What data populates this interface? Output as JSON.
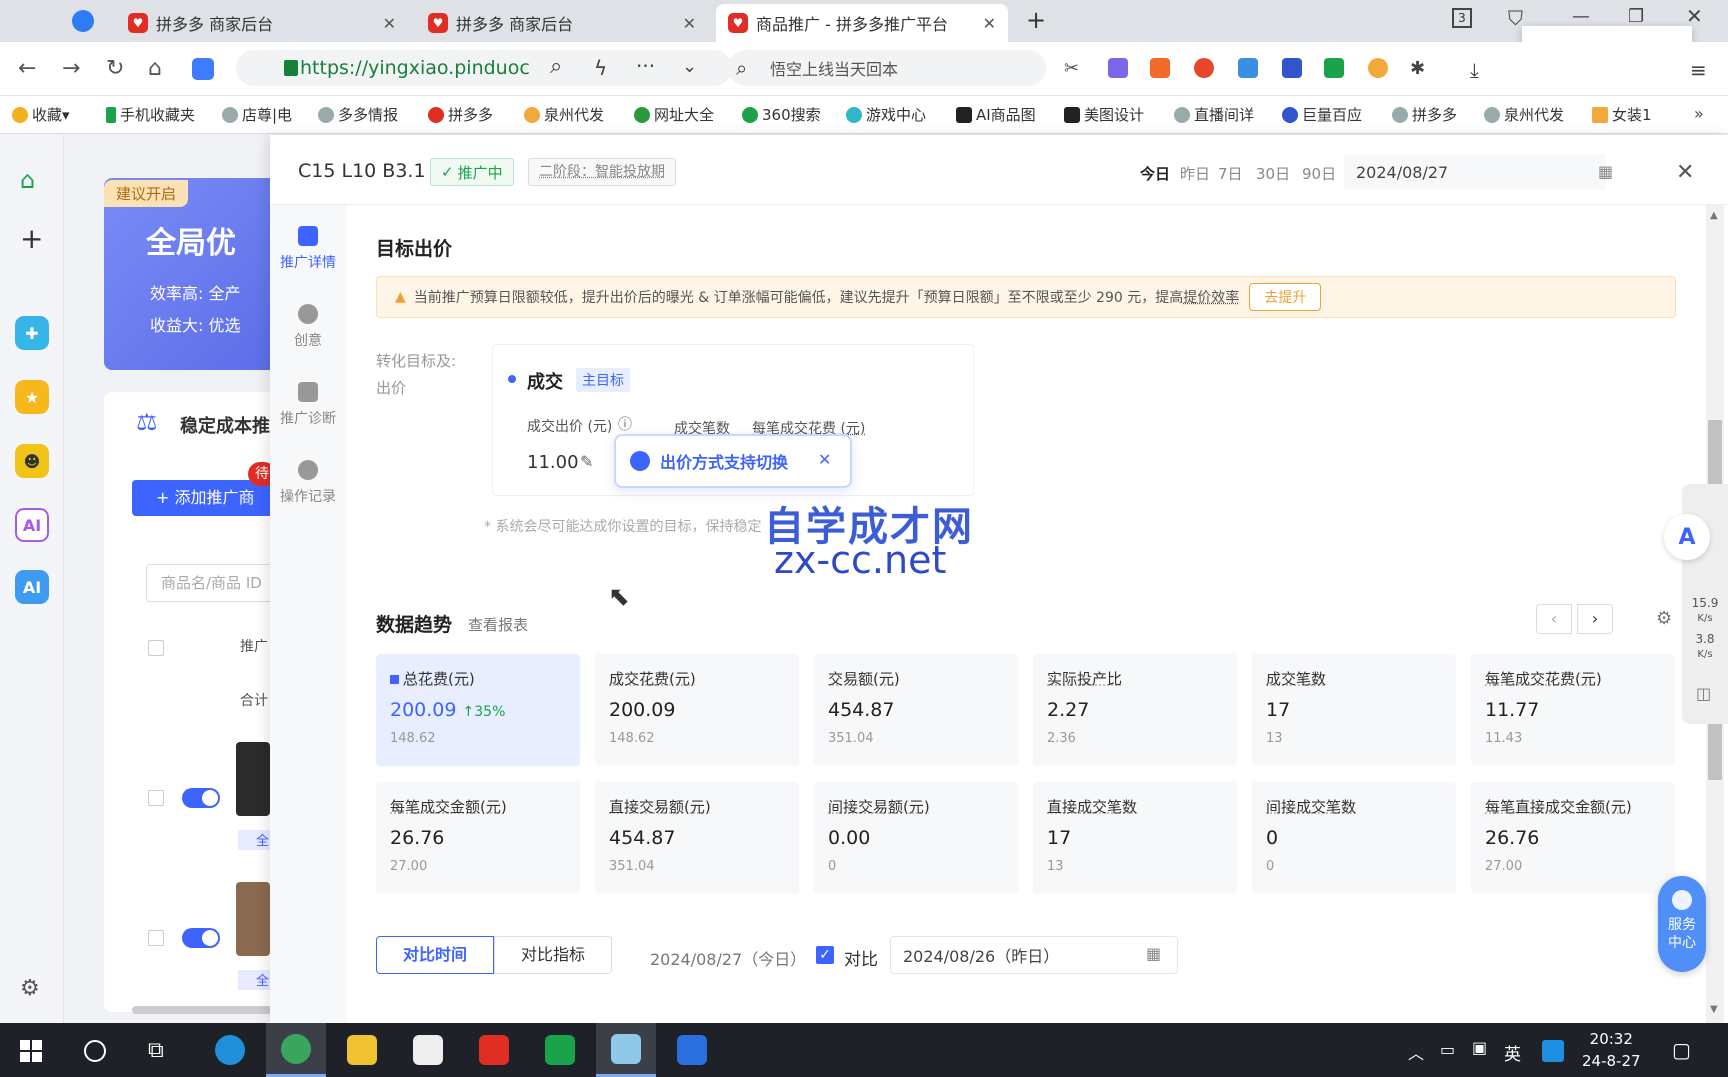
{
  "browser": {
    "tabs": [
      {
        "label": "拼多多 商家后台"
      },
      {
        "label": "拼多多 商家后台"
      },
      {
        "label": "商品推广 - 拼多多推广平台"
      }
    ],
    "tab_count_badge": "3",
    "url": "https://yingxiao.pinduoc",
    "search_placeholder": "悟空上线当天回本",
    "bookmarks": [
      "收藏",
      "手机收藏夹",
      "店尊|电",
      "多多情报",
      "拼多多",
      "泉州代发",
      "网址大全",
      "360搜索",
      "游戏中心",
      "AI商品图",
      "美图设计",
      "直播间详",
      "巨量百应",
      "拼多多",
      "泉州代发",
      "女装1"
    ]
  },
  "background": {
    "suggest_badge": "建议开启",
    "promo_title": "全局优",
    "promo_line1": "效率高: 全产",
    "promo_line2": "收益大: 优选",
    "stable_title": "稳定成本推",
    "add_button": "+ 添加推广商",
    "pending_badge": "待",
    "search_placeholder": "商品名/商品 ID",
    "col_promo": "推广",
    "total_row": "合计",
    "tag": "全"
  },
  "panel": {
    "title": "C15 L10 B3.1",
    "status": "推广中",
    "phase": "二阶段：智能投放期",
    "range_tabs": [
      "今日",
      "昨日",
      "7日",
      "30日",
      "90日"
    ],
    "date": "2024/08/27",
    "nav": [
      {
        "label": "推广详情",
        "icon": "list-icon"
      },
      {
        "label": "创意",
        "icon": "bulb-icon"
      },
      {
        "label": "推广诊断",
        "icon": "clipboard-icon"
      },
      {
        "label": "操作记录",
        "icon": "clock-icon"
      }
    ],
    "section_bid": "目标出价",
    "alert_text": "当前推广预算日限额较低，提升出价后的曝光 & 订单涨幅可能偏低，建议先提升「预算日限额」至不限或至少 290 元，提高",
    "alert_link": "提价效率",
    "alert_button": "去提升",
    "conv_label": "转化目标及出价",
    "conv_label_l1": "转化目标及:",
    "conv_label_l2": "出价",
    "goal": "成交",
    "goal_tag": "主目标",
    "bid_label": "成交出价 (元)",
    "col2": "成交笔数",
    "col3": "每笔成交花费 (元)",
    "bid_value": "11.00",
    "popover": "出价方式支持切换",
    "note": "* 系统会尽可能达成你设置的目标，保持稳定",
    "watermark1": "自学成才网",
    "watermark2": "zx-cc.net",
    "section_trend": "数据趋势",
    "view_report": "查看报表",
    "metrics": [
      {
        "title": "总花费(元)",
        "value": "200.09",
        "change": "35%",
        "prev": "148.62"
      },
      {
        "title": "成交花费(元)",
        "value": "200.09",
        "prev": "148.62"
      },
      {
        "title": "交易额(元)",
        "value": "454.87",
        "prev": "351.04"
      },
      {
        "title": "实际投产比",
        "value": "2.27",
        "prev": "2.36"
      },
      {
        "title": "成交笔数",
        "value": "17",
        "prev": "13"
      },
      {
        "title": "每笔成交花费(元)",
        "value": "11.77",
        "prev": "11.43"
      },
      {
        "title": "每笔成交金额(元)",
        "value": "26.76",
        "prev": "27.00"
      },
      {
        "title": "直接交易额(元)",
        "value": "454.87",
        "prev": "351.04"
      },
      {
        "title": "间接交易额(元)",
        "value": "0.00",
        "prev": "0"
      },
      {
        "title": "直接成交笔数",
        "value": "17",
        "prev": "13"
      },
      {
        "title": "间接成交笔数",
        "value": "0",
        "prev": "0"
      },
      {
        "title": "每笔直接成交金额(元)",
        "value": "26.76",
        "prev": "27.00"
      }
    ],
    "compare_tabs": [
      "对比时间",
      "对比指标"
    ],
    "date_today": "2024/08/27（今日）",
    "compare_label": "对比",
    "date_yesterday": "2024/08/26（昨日）",
    "service": "服务中心",
    "speed_up": "15.9",
    "speed_down": "3.8",
    "speed_unit": "K/s"
  },
  "taskbar": {
    "ime": "英",
    "time": "20:32",
    "date": "24-8-27"
  },
  "colors": {
    "accent": "#3e64ff",
    "brand": "#e02e24",
    "warn": "#f0a030"
  }
}
